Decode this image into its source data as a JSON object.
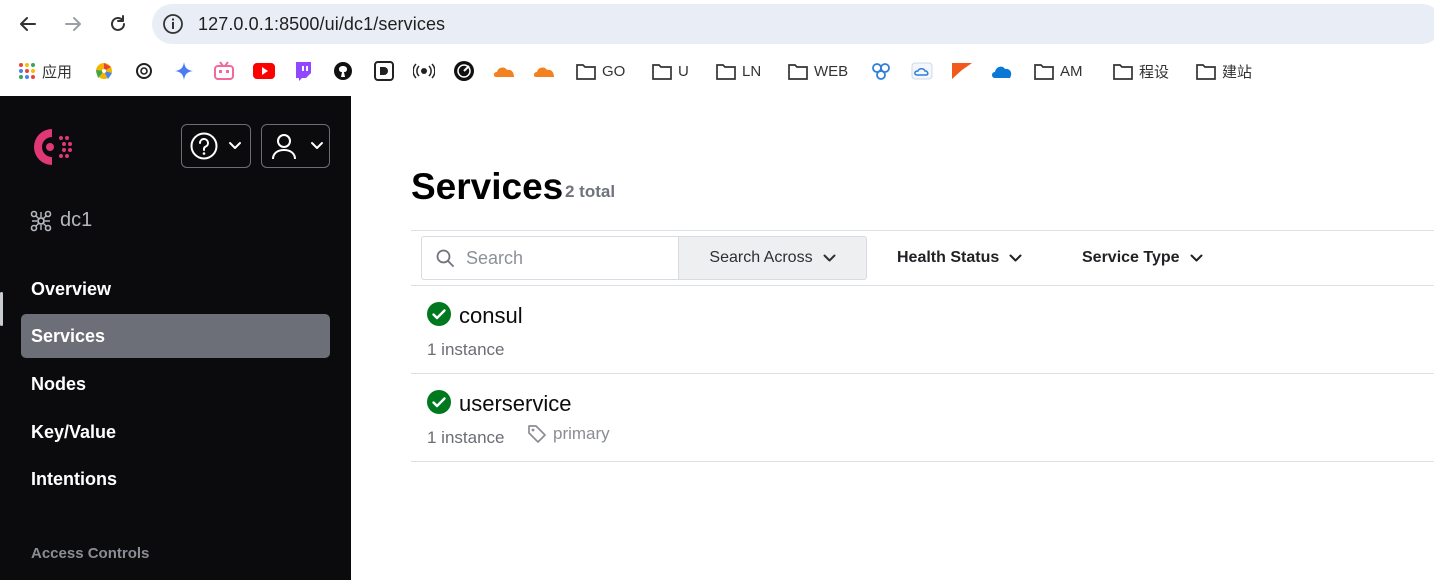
{
  "browser": {
    "url": "127.0.0.1:8500/ui/dc1/services",
    "bookmarks": {
      "apps": "应用",
      "go": "GO",
      "u": "U",
      "ln": "LN",
      "web": "WEB",
      "am": "AM",
      "chengshe": "程设",
      "jianzhan": "建站"
    }
  },
  "sidebar": {
    "datacenter": "dc1",
    "nav": {
      "overview": "Overview",
      "services": "Services",
      "nodes": "Nodes",
      "keyvalue": "Key/Value",
      "intentions": "Intentions"
    },
    "section_access_controls": "Access Controls"
  },
  "main": {
    "title": "Services",
    "total": "2 total",
    "filters": {
      "search_placeholder": "Search",
      "search_across": "Search Across",
      "health_status": "Health Status",
      "service_type": "Service Type"
    },
    "services": [
      {
        "name": "consul",
        "instances": "1 instance",
        "status": "passing"
      },
      {
        "name": "userservice",
        "instances": "1 instance",
        "tag": "primary",
        "status": "passing"
      }
    ]
  },
  "colors": {
    "consul_brand": "#e03875",
    "passing": "#00781e",
    "sidebar_bg": "#0b0b0e",
    "active_nav": "#6c6f77"
  }
}
